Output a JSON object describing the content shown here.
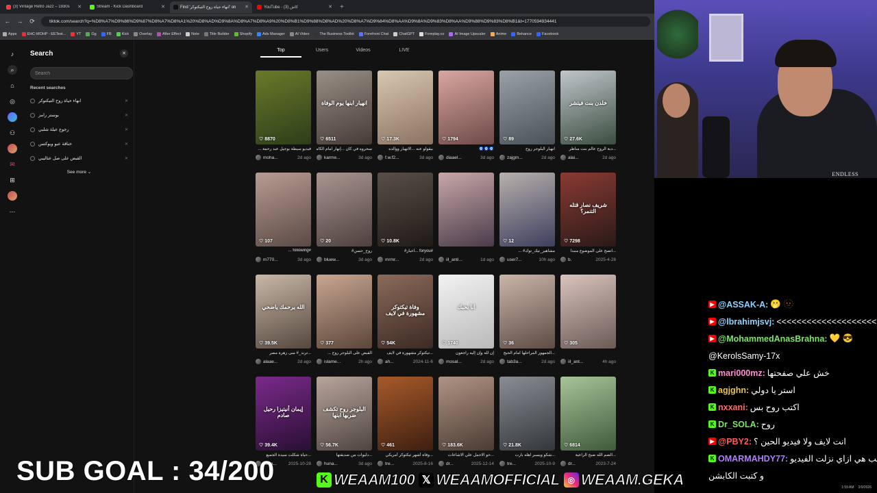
{
  "browser": {
    "tabs": [
      {
        "title": "(3) Vintage Retro Jazz – 1930s",
        "color": "#ff3b3b",
        "active": false
      },
      {
        "title": "Stream - Kick Dashboard",
        "color": "#53fc18",
        "active": false
      },
      {
        "title": "Find 'انهاء حياة روح التيكتوكر' on",
        "color": "#111111",
        "active": true
      },
      {
        "title": "YouTube - (3) كاش",
        "color": "#ff0000",
        "active": false
      }
    ],
    "new_tab": "+",
    "url": "tiktok.com/search?q=%D8%A7%D9%86%D9%87%D8%A7%D8%A1%20%D8%AD%D9%8A%D8%A7%D8%A9%20%D8%B1%D9%88%D8%AD%20%D8%A7%D9%84%D8%AA%D9%8A%D9%83%D8%AA%D9%88%D9%83%D8%B1&t=1770594934441",
    "bookmarks": [
      "Apps",
      "EHC-MOHP - EETest...",
      "YT",
      "Gg",
      "FB",
      "Kick",
      "Overlay",
      "After Effect",
      "Note",
      "Title Builder",
      "Shopify",
      "Ads Manager",
      "AI Video",
      "The Business Toolkit",
      "Forefront Chat",
      "ChatGPT",
      "Foreplay.co",
      "AI Image Upscaler",
      "Anime",
      "Behance",
      "Facebook"
    ]
  },
  "search_panel": {
    "title": "Search",
    "placeholder": "Search",
    "recent_label": "Recent searches",
    "recent": [
      "انهاء حياة روح التيكتوكر",
      "بوستر رامز",
      "رجوع عيلة شلبي",
      "خناقة عبو ويوكتس",
      "القبض على صل عتاليبي"
    ],
    "see_more": "See more"
  },
  "result_tabs": [
    "Top",
    "Users",
    "Videos",
    "LIVE"
  ],
  "videos": [
    {
      "likes": "8870",
      "caption": "فيديو سيطة بوجيل عبد رحمة ...",
      "user": "moha...",
      "date": "2d ago",
      "overlay": "",
      "bg": "linear-gradient(160deg,#6a7a2a,#2d3d1a)"
    },
    {
      "likes": "6511",
      "caption": "سحروه في كان ...إنهار امام الكاميرا",
      "user": "karme...",
      "date": "3d ago",
      "overlay": "انهيار ابنها يوم الوفاة",
      "bg": "linear-gradient(160deg,#9a8f86,#463b36)"
    },
    {
      "likes": "17.3K",
      "caption": "بيقولو عنه ...الانهيار ووالده",
      "user": "f.w.f2...",
      "date": "3d ago",
      "overlay": "",
      "bg": "linear-gradient(160deg,#d9c7b0,#8a7361)"
    },
    {
      "likes": "1794",
      "caption": "🧿🧿🧿",
      "user": "diaael...",
      "date": "3d ago",
      "overlay": "",
      "bg": "linear-gradient(160deg,#d9a6a0,#6d4a48)"
    },
    {
      "likes": "89",
      "caption": "انهيار البلوجر روح",
      "user": "zajgm...",
      "date": "2d ago",
      "overlay": "",
      "bg": "linear-gradient(160deg,#9aa1a8,#4b5158)"
    },
    {
      "likes": "27.6K",
      "caption": "...دبة الروح عالم بنت مناظر",
      "user": "alai...",
      "date": "2d ago",
      "overlay": "خلدن بنت فيتشر",
      "bg": "linear-gradient(160deg,#c0c6cc,#3a4d3f)"
    },
    {
      "likes": "107",
      "caption": "#following ...",
      "user": "m770...",
      "date": "3d ago",
      "overlay": "",
      "bg": "linear-gradient(160deg,#b89c93,#5a4a44)"
    },
    {
      "likes": "20",
      "caption": "روح_حسن#",
      "user": "bluew...",
      "date": "3d ago",
      "overlay": "",
      "bg": "linear-gradient(160deg,#a99590,#4d403d)"
    },
    {
      "likes": "10.8K",
      "caption": "#foryou ...اخبار#",
      "user": "mrmr...",
      "date": "2d ago",
      "overlay": "",
      "bg": "linear-gradient(160deg,#5a4f48,#201a17)"
    },
    {
      "likes": "",
      "caption": "",
      "user": "iil_anti...",
      "date": "1d ago",
      "overlay": "",
      "bg": "linear-gradient(160deg,#c7a8a8,#4a3b4a)"
    },
    {
      "likes": "12",
      "caption": "مشاهير_تيك_توك# ...",
      "user": "user7...",
      "date": "10h ago",
      "overlay": "",
      "bg": "linear-gradient(160deg,#b8b0ad,#3e3f5e)"
    },
    {
      "likes": "7298",
      "caption": "...اتصح على الموضوع منبدا",
      "user": "b.",
      "date": "2025-4-28",
      "overlay": "شريف نصار قتله التنمر؟",
      "bg": "linear-gradient(160deg,#8a3a33,#2a1a18)"
    },
    {
      "likes": "39.5K",
      "caption": "...ترند_# منى زهرة مصر",
      "user": "alaae...",
      "date": "2d ago",
      "overlay": "الله يرحمك ياضحي",
      "bg": "linear-gradient(160deg,#c9b8a8,#54473d)"
    },
    {
      "likes": "377",
      "caption": "القبض على البلوجر روح ...",
      "user": "islame...",
      "date": "2h ago",
      "overlay": "",
      "bg": "linear-gradient(160deg,#c9a691,#5b463a)"
    },
    {
      "likes": "54K",
      "caption": "...تيكتوكر مشهورة في لايف",
      "user": "ah...",
      "date": "2024-11-6",
      "overlay": "وفاة تيكتوكر مشهورة في لايف",
      "bg": "linear-gradient(160deg,#8c6a5a,#3b2a24)"
    },
    {
      "likes": "1740",
      "caption": "إن لله وإن إليه راجعون",
      "user": "mosal...",
      "date": "2d ago",
      "overlay": "انا بحبك",
      "bg": "linear-gradient(160deg,#f2f2f2,#b9b9b9)"
    },
    {
      "likes": "36",
      "caption": "...الجمهور المراحلها امام الحيج",
      "user": "tab3a...",
      "date": "2d ago",
      "overlay": "",
      "bg": "linear-gradient(160deg,#cbb5a9,#5d4c44)"
    },
    {
      "likes": "305",
      "caption": "",
      "user": "iil_ant...",
      "date": "4h ago",
      "overlay": "",
      "bg": "linear-gradient(160deg,#d9c3bd,#6b5a56)"
    },
    {
      "likes": "39.4K",
      "caption": "...حياة شكلت سيدة الجميع",
      "user": "huna...",
      "date": "2025-10-28",
      "overlay": "إيمان أنيتيزا رحيل صادم",
      "bg": "linear-gradient(160deg,#7a2a8a,#2a0f33)"
    },
    {
      "likes": "56.7K",
      "caption": "...دليوات من صديقتها",
      "user": "huna...",
      "date": "3d ago",
      "overlay": "البلوجر روح تكشف ضربها ابنها",
      "bg": "linear-gradient(160deg,#b8a59c,#4f4440)"
    },
    {
      "likes": "461",
      "caption": "...وفاة أشهر تيكتوكر أمريكي",
      "user": "tre...",
      "date": "2025-8-16",
      "overlay": "",
      "bg": "linear-gradient(160deg,#a85a2a,#3d1f10)"
    },
    {
      "likes": "183.6K",
      "caption": "...حو الاجمل علي الاشاعات",
      "user": "dr...",
      "date": "2025-12-14",
      "overlay": "",
      "bg": "linear-gradient(160deg,#b09484,#4a3b33)"
    },
    {
      "likes": "21.8K",
      "caption": "...شكو ويسبر اهله بارت",
      "user": "tre...",
      "date": "2025-10-9",
      "overlay": "",
      "bg": "linear-gradient(160deg,#8a8e94,#33363a)"
    },
    {
      "likes": "6814",
      "caption": "...الضم الله ضبح الراعية",
      "user": "dr...",
      "date": "2023-7-24",
      "overlay": "",
      "bg": "linear-gradient(160deg,#a8c49a,#3e5a3a)"
    }
  ],
  "webcam": {
    "label": "ENDLESS"
  },
  "chat": [
    {
      "platform": "yt",
      "name": "@ASSAK-A:",
      "color": "#8fd3ff",
      "text": "🫢 🫥"
    },
    {
      "platform": "yt",
      "name": "@lbrahimjsvj:",
      "color": "#8fd3ff",
      "text": "<<<<<<<<<<<<<<<<<<<<<"
    },
    {
      "platform": "yt",
      "name": "@MohammedAnasBrahna:",
      "color": "#7fe36b",
      "text": "💛 😎"
    },
    {
      "platform": "",
      "name": "",
      "color": "#ffffff",
      "text": "@KerolsSamy-17x"
    },
    {
      "platform": "kk",
      "name": "mari000mz:",
      "color": "#ff8fd1",
      "text": "خش علي صفحتها"
    },
    {
      "platform": "kk",
      "name": "agjghn:",
      "color": "#e8c44a",
      "text": "استر يا دولي"
    },
    {
      "platform": "kk",
      "name": "nxxani:",
      "color": "#ff6b6b",
      "text": "اكتب روح بس"
    },
    {
      "platform": "kk",
      "name": "Dr_SOLA:",
      "color": "#7fe36b",
      "text": "روح"
    },
    {
      "platform": "yt",
      "name": "@PBY2:",
      "color": "#ff5a5a",
      "text": "انت لايف ولا فيديو الحين ؟"
    },
    {
      "platform": "kk",
      "name": "OMARMAHDY77:",
      "color": "#b07cff",
      "text": "طب هي ازاي نزلت الفيديو"
    },
    {
      "platform": "",
      "name": "",
      "color": "#ffffff",
      "text": "و كتبت الكابشن"
    }
  ],
  "overlay": {
    "sub_goal": "SUB GOAL : 34/200",
    "socials": [
      {
        "icon": "k",
        "handle": "WEAAM100"
      },
      {
        "icon": "x",
        "handle": "WEAAMOFFICIAL"
      },
      {
        "icon": "ig",
        "handle": "WEAAM.GEKA"
      }
    ],
    "clock": "1:59 AM",
    "date": "2/9/2026"
  }
}
